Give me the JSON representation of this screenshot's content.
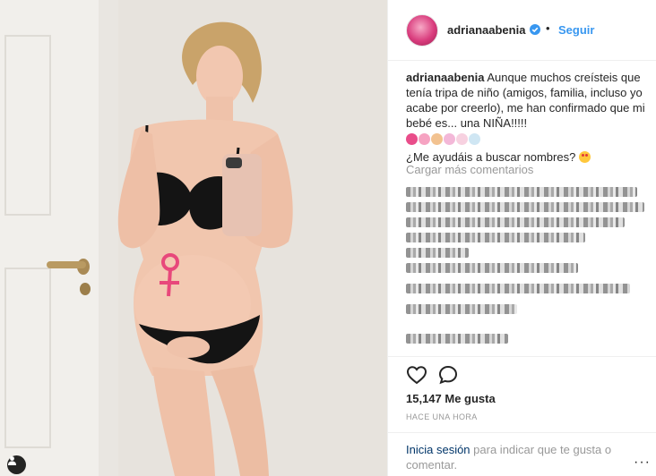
{
  "post": {
    "username": "adrianaabenia",
    "follow_label": "Seguir",
    "separator": "•",
    "caption_user": "adrianaabenia",
    "caption_text": "Aunque muchos creísteis que tenía tripa de niño (amigos, familia, incluso yo acabe por creerlo), me han confirmado que mi bebé es... una NIÑA!!!!!",
    "caption_question": "¿Me ayudáis a buscar nombres?",
    "load_more": "Cargar más comentarios",
    "likes": "15,147 Me gusta",
    "time_ago": "HACE UNA HORA",
    "login_link": "Inicia sesión",
    "login_text": "para indicar que te gusta o comentar.",
    "options_label": "···"
  },
  "icons": {
    "verified": "verified-badge-icon",
    "heart": "heart-outline-icon",
    "comment": "comment-bubble-icon",
    "user_tag": "user-tag-icon"
  },
  "colors": {
    "link_blue": "#3897f0",
    "login_blue": "#003569",
    "muted": "#999999",
    "text": "#262626"
  }
}
